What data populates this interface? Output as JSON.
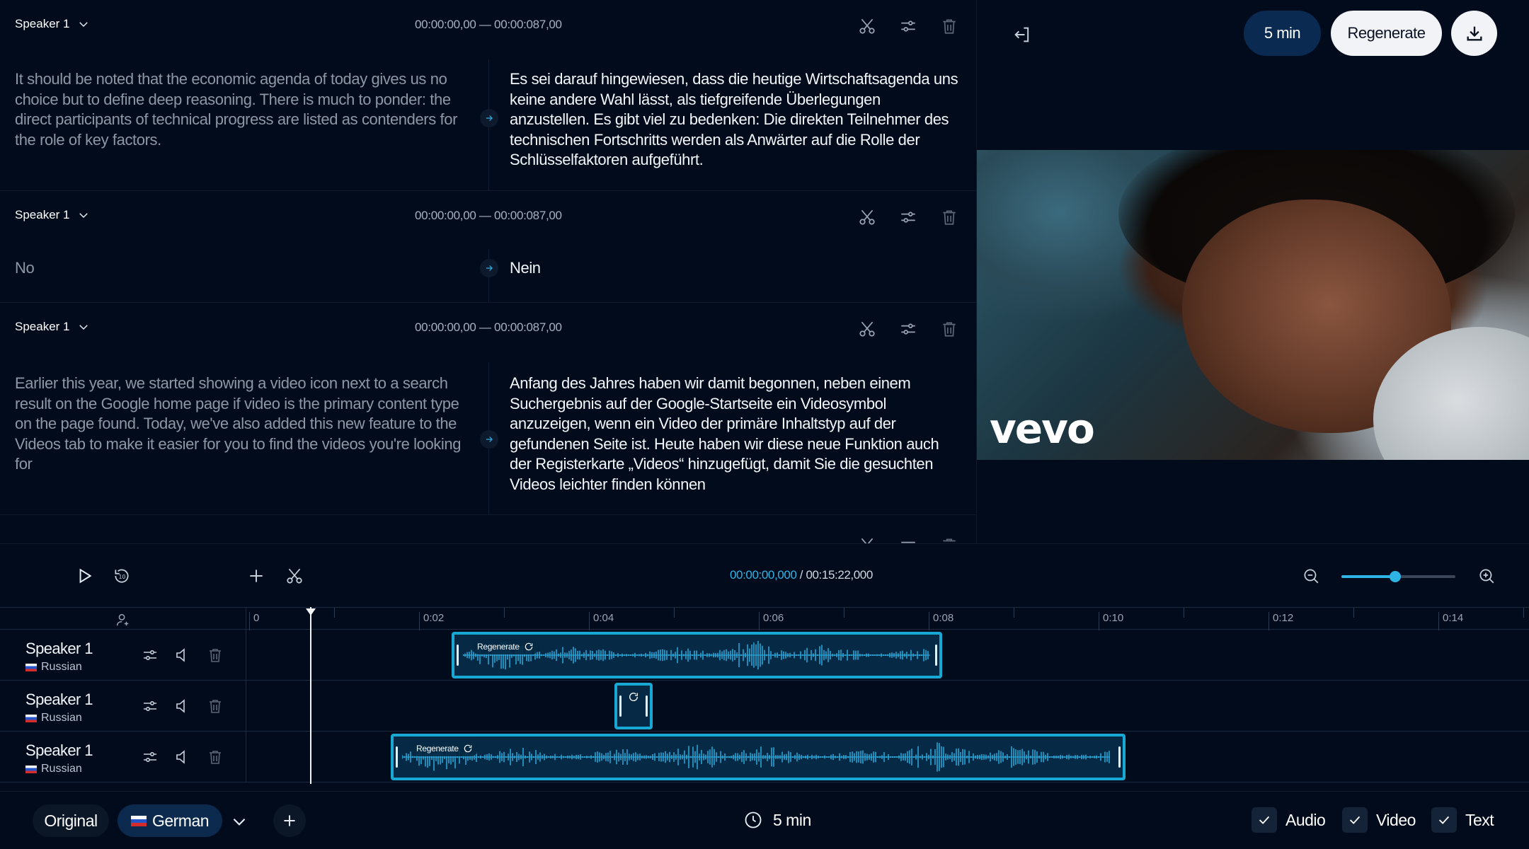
{
  "transcript": {
    "segments": [
      {
        "speaker": "Speaker 1",
        "timecode": "00:00:00,00 — 00:00:087,00",
        "source": "It should be noted that the economic agenda of today gives us no choice but to define deep reasoning. There is much to ponder: the direct participants of technical progress are listed as contenders for the role of key factors.",
        "target": "Es sei darauf hingewiesen, dass die heutige Wirtschaftsagenda uns keine andere Wahl lässt, als tiefgreifende Überlegungen anzustellen. Es gibt viel zu bedenken: Die direkten Teilnehmer des technischen Fortschritts werden als Anwärter auf die Rolle der Schlüsselfaktoren aufgeführt."
      },
      {
        "speaker": "Speaker 1",
        "timecode": "00:00:00,00 — 00:00:087,00",
        "source": "No",
        "target": "Nein"
      },
      {
        "speaker": "Speaker 1",
        "timecode": "00:00:00,00 — 00:00:087,00",
        "source": "Earlier this year, we started showing a video icon next to a search result on the Google home page if video is the primary content type on the page found. Today, we've also added this new feature to the Videos tab to make it easier for you to find the videos you're looking for",
        "target": "Anfang des Jahres haben wir damit begonnen, neben einem Suchergebnis auf der Google-Startseite ein Videosymbol anzuzeigen, wenn ein Video der primäre Inhaltstyp auf der gefundenen Seite ist. Heute haben wir diese neue Funktion auch der Registerkarte „Videos“ hinzugefügt, damit Sie die gesuchten Videos leichter finden können"
      }
    ]
  },
  "topbar": {
    "duration_label": "5 min",
    "regenerate_label": "Regenerate"
  },
  "video": {
    "watermark": "vevo"
  },
  "player": {
    "current_time": "00:00:00,000",
    "separator": " / ",
    "total_time": "00:15:22,000",
    "zoom_level": 0.47
  },
  "timeline": {
    "ticks": [
      "0",
      "0:02",
      "0:04",
      "0:06",
      "0:08",
      "0:10",
      "0:12",
      "0:14"
    ],
    "tracks": [
      {
        "name": "Speaker 1",
        "language": "Russian",
        "clip_label": "Regenerate"
      },
      {
        "name": "Speaker 1",
        "language": "Russian",
        "clip_label": ""
      },
      {
        "name": "Speaker 1",
        "language": "Russian",
        "clip_label": "Regenerate"
      }
    ]
  },
  "bottombar": {
    "original_label": "Original",
    "language_label": "German",
    "duration_label": "5 min",
    "toggles": [
      {
        "label": "Audio",
        "checked": true
      },
      {
        "label": "Video",
        "checked": true
      },
      {
        "label": "Text",
        "checked": true
      }
    ]
  },
  "colors": {
    "background": "#020b1b",
    "accent": "#17a9d4",
    "time_highlight": "#2fb4e6",
    "pill_dark": "#0a2a52"
  }
}
